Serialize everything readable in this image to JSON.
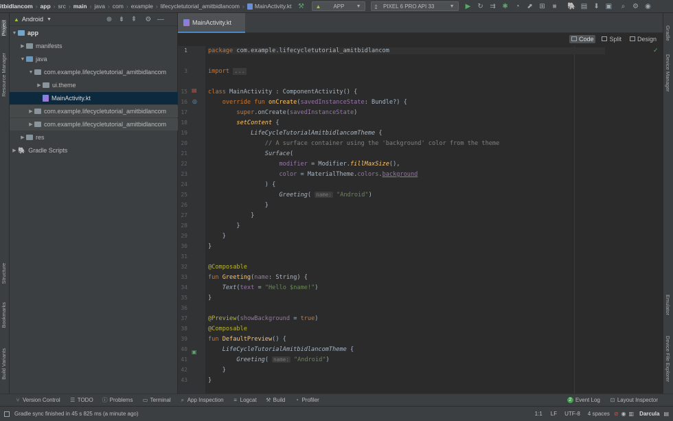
{
  "breadcrumb": [
    "itbidlancom",
    "app",
    "src",
    "main",
    "java",
    "com",
    "example",
    "lifecycletutorial_amitbidlancom",
    "MainActivity.kt"
  ],
  "toolbar": {
    "config_label": "APP",
    "device_label": "PIXEL 6 PRO API 33"
  },
  "left_tabs": [
    "Project",
    "Resource Manager",
    "Structure",
    "Bookmarks",
    "Build Variants"
  ],
  "right_tabs": [
    "Gradle",
    "Device Manager",
    "Emulator",
    "Device File Explorer"
  ],
  "project": {
    "view_label": "Android",
    "tree": [
      {
        "label": "app",
        "bold": true
      },
      {
        "label": "manifests"
      },
      {
        "label": "java"
      },
      {
        "label": "com.example.lifecycletutorial_amitbidlancom"
      },
      {
        "label": "ui.theme"
      },
      {
        "label": "MainActivity.kt"
      },
      {
        "label": "com.example.lifecycletutorial_amitbidlancom"
      },
      {
        "label": "com.example.lifecycletutorial_amitbidlancom"
      },
      {
        "label": "res"
      },
      {
        "label": "Gradle Scripts"
      }
    ]
  },
  "editor": {
    "tab_label": "MainActivity.kt",
    "modes": [
      "Code",
      "Split",
      "Design"
    ],
    "active_mode": "Code",
    "line_numbers": [
      "1",
      "3",
      "15",
      "16",
      "17",
      "18",
      "19",
      "20",
      "21",
      "22",
      "23",
      "24",
      "25",
      "26",
      "27",
      "28",
      "29",
      "30",
      "31",
      "32",
      "33",
      "34",
      "35",
      "36",
      "37",
      "38",
      "39",
      "40",
      "41",
      "42",
      "43"
    ],
    "code": {
      "l1": "com.example.lifecycletutorial_amitbidlancom",
      "l20": "// A surface container using the 'background' color from the theme",
      "greeting_hint": "name:",
      "android_str": "\"Android\"",
      "hello_str": "\"Hello $name!\"",
      "theme_name": "LifeCycleTutorialAmitbidlancomTheme"
    }
  },
  "bottom_tools": [
    "Version Control",
    "TODO",
    "Problems",
    "Terminal",
    "App Inspection",
    "Logcat",
    "Build",
    "Profiler",
    "Event Log",
    "Layout Inspector"
  ],
  "event_log_count": "2",
  "status": {
    "message": "Gradle sync finished in 45 s 825 ms (a minute ago)",
    "position": "1:1",
    "line_sep": "LF",
    "encoding": "UTF-8",
    "indent": "4 spaces",
    "theme": "Darcula"
  }
}
